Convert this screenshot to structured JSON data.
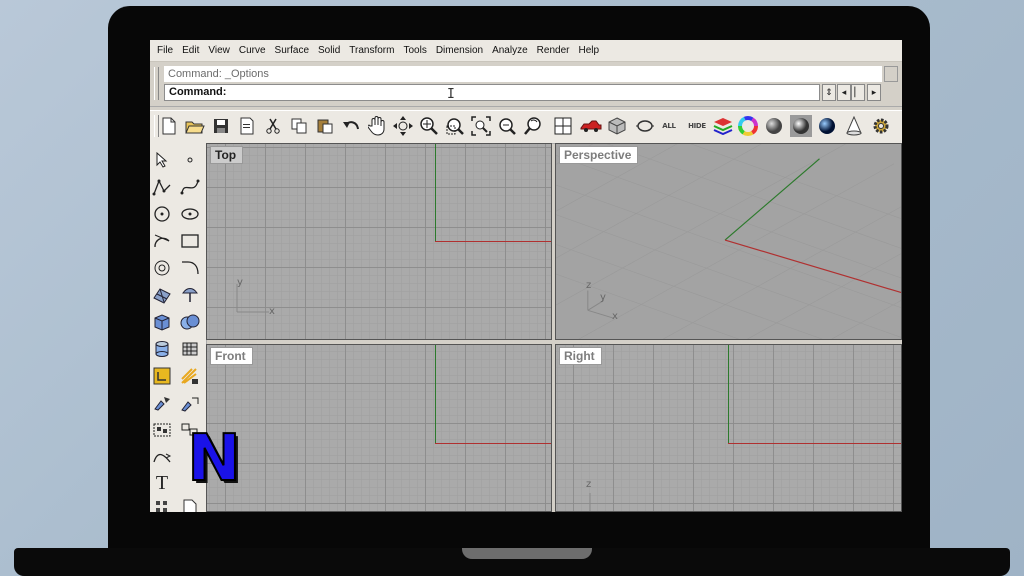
{
  "menu": [
    "File",
    "Edit",
    "View",
    "Curve",
    "Surface",
    "Solid",
    "Transform",
    "Tools",
    "Dimension",
    "Analyze",
    "Render",
    "Help"
  ],
  "command": {
    "history": "Command: _Options",
    "prompt": "Command:",
    "value": ""
  },
  "toolbar": {
    "all_label": "ALL",
    "hide_label": "HIDE",
    "icons": [
      "new-file-icon",
      "open-folder-icon",
      "save-icon",
      "print-icon",
      "cut-icon",
      "copy-icon",
      "paste-icon",
      "undo-icon",
      "pan-hand-icon",
      "move-view-icon",
      "zoom-dynamic-icon",
      "zoom-window-icon",
      "zoom-extents-icon",
      "zoom-selected-icon",
      "rotate-view-icon",
      "four-viewports-icon",
      "car-icon",
      "object-properties-icon",
      "select-objects-icon",
      "all-label-icon",
      "hide-label-icon",
      "layers-icon",
      "color-wheel-icon",
      "render-sphere-icon",
      "shaded-sphere-icon",
      "blue-sphere-icon",
      "light-cone-icon",
      "gear-icon"
    ]
  },
  "left_toolbar": {
    "text_tool_label": "T"
  },
  "viewports": {
    "top": "Top",
    "perspective": "Perspective",
    "front": "Front",
    "right": "Right"
  },
  "axes": {
    "x": "x",
    "y": "y",
    "z": "z"
  },
  "logo": {
    "letter": "N"
  },
  "colors": {
    "x_axis": "#b03030",
    "y_axis": "#2c7a2c",
    "logo_fill": "#1a12e8"
  }
}
